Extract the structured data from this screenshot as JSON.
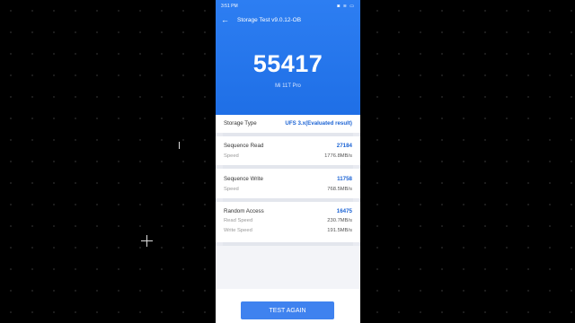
{
  "status_bar": {
    "time": "3:51 PM",
    "icons": "◙ ≋ ▭"
  },
  "app_bar": {
    "title": "Storage Test v9.0.12-OB"
  },
  "result": {
    "score": "55417",
    "device": "Mi 11T Pro"
  },
  "storage_type": {
    "label": "Storage Type",
    "value": "UFS 3.x(Evaluated result)"
  },
  "sequence_read": {
    "label": "Sequence Read",
    "score": "27184",
    "speed_label": "Speed",
    "speed_value": "1776.8MB/s"
  },
  "sequence_write": {
    "label": "Sequence Write",
    "score": "11758",
    "speed_label": "Speed",
    "speed_value": "768.5MB/s"
  },
  "random_access": {
    "label": "Random Access",
    "score": "16475",
    "read_label": "Read Speed",
    "read_value": "230.7MB/s",
    "write_label": "Write Speed",
    "write_value": "191.5MB/s"
  },
  "action": {
    "test_again": "TEST AGAIN"
  },
  "colors": {
    "header": "#2d7ef2",
    "accent": "#1b63d4",
    "button": "#3f82ef"
  }
}
